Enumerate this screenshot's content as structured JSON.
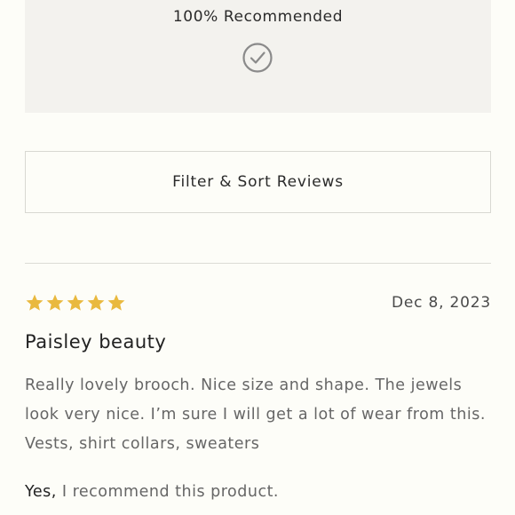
{
  "summary": {
    "title": "100% Recommended",
    "icon": "check-circle-icon"
  },
  "filter": {
    "label": "Filter & Sort Reviews"
  },
  "review": {
    "rating": 5,
    "max_rating": 5,
    "star_color": "#e9b93f",
    "date": "Dec 8, 2023",
    "title": "Paisley beauty",
    "body": "Really lovely brooch. Nice size and shape. The jewels look very nice. I’m sure I will get a lot of wear from this. Vests, shirt collars, sweaters",
    "recommend_yes": "Yes,",
    "recommend_text": " I recommend this product."
  }
}
